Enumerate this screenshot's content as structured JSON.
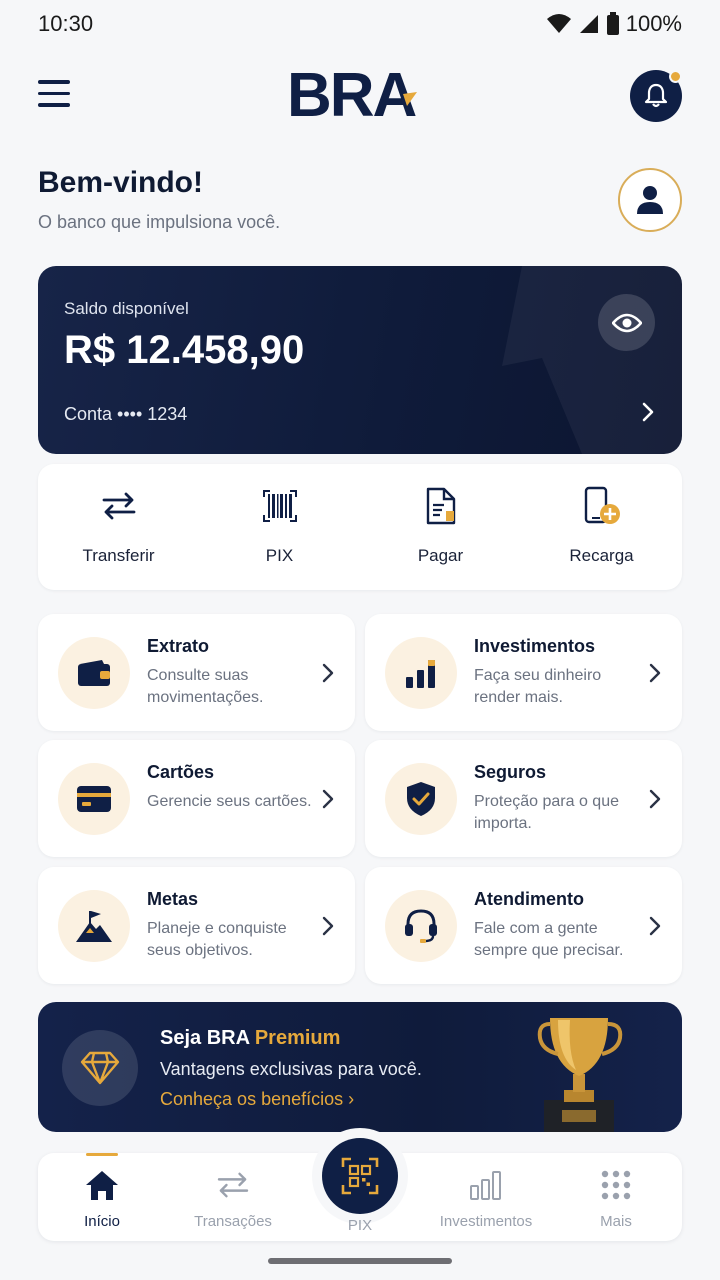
{
  "status_bar": {
    "time": "10:30",
    "battery": "100%"
  },
  "header": {
    "logo_text": "BRA"
  },
  "welcome": {
    "title": "Bem-vindo!",
    "subtitle": "O banco que impulsiona você."
  },
  "balance": {
    "label": "Saldo disponível",
    "value": "R$ 12.458,90",
    "account": "Conta •••• 1234"
  },
  "quick_actions": [
    {
      "label": "Transferir",
      "icon": "transfer-arrows-icon"
    },
    {
      "label": "PIX",
      "icon": "barcode-icon"
    },
    {
      "label": "Pagar",
      "icon": "document-pay-icon"
    },
    {
      "label": "Recarga",
      "icon": "phone-plus-icon"
    }
  ],
  "tiles": [
    {
      "title": "Extrato",
      "desc": "Consulte suas movimentações.",
      "icon": "wallet-icon"
    },
    {
      "title": "Investimentos",
      "desc": "Faça seu dinheiro render mais.",
      "icon": "bar-chart-icon"
    },
    {
      "title": "Cartões",
      "desc": "Gerencie seus cartões.",
      "icon": "credit-card-icon"
    },
    {
      "title": "Seguros",
      "desc": "Proteção para o que importa.",
      "icon": "shield-check-icon"
    },
    {
      "title": "Metas",
      "desc": "Planeje e conquiste seus objetivos.",
      "icon": "mountain-flag-icon"
    },
    {
      "title": "Atendimento",
      "desc": "Fale com a gente sempre que precisar.",
      "icon": "headset-icon"
    }
  ],
  "premium": {
    "title_prefix": "Seja BRA ",
    "title_highlight": "Premium",
    "subtitle": "Vantagens exclusivas para você.",
    "link": "Conheça os benefícios"
  },
  "bottom_nav": [
    {
      "label": "Início",
      "icon": "home-icon",
      "active": true
    },
    {
      "label": "Transações",
      "icon": "transfer-arrows-icon"
    },
    {
      "label": "PIX",
      "icon": "qr-scan-icon"
    },
    {
      "label": "Investimentos",
      "icon": "bar-chart-icon"
    },
    {
      "label": "Mais",
      "icon": "grid-dots-icon"
    }
  ],
  "colors": {
    "navy": "#0f1f45",
    "gold": "#e6a93c",
    "background": "#f6f7f9"
  }
}
